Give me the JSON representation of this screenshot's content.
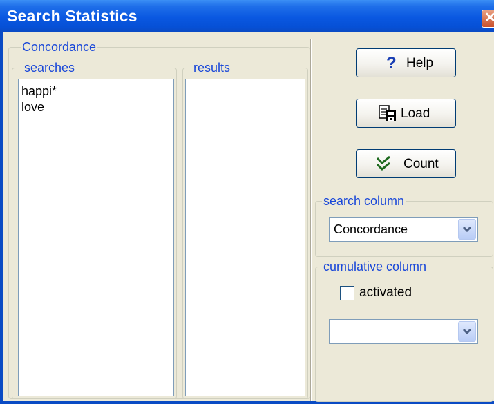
{
  "window": {
    "title": "Search Statistics"
  },
  "concordance": {
    "legend": "Concordance",
    "searches": {
      "legend": "searches",
      "items": [
        "happi*",
        "love"
      ]
    },
    "results": {
      "legend": "results",
      "items": []
    }
  },
  "buttons": {
    "help": "Help",
    "load": "Load",
    "count": "Count"
  },
  "search_column": {
    "legend": "search column",
    "selected": "Concordance"
  },
  "cumulative_column": {
    "legend": "cumulative column",
    "checkbox_label": "activated",
    "checked": false,
    "selected": ""
  },
  "colors": {
    "titlebar": "#0a58e1",
    "legend_text": "#1a48d9",
    "window_bg": "#ece9d8",
    "help_icon": "#1a3fb4",
    "count_icon": "#1e6a1e"
  },
  "icons": {
    "close": "close-icon",
    "help": "question-mark-icon",
    "load": "load-icon",
    "count": "double-check-icon",
    "dropdown": "chevron-down-icon"
  }
}
